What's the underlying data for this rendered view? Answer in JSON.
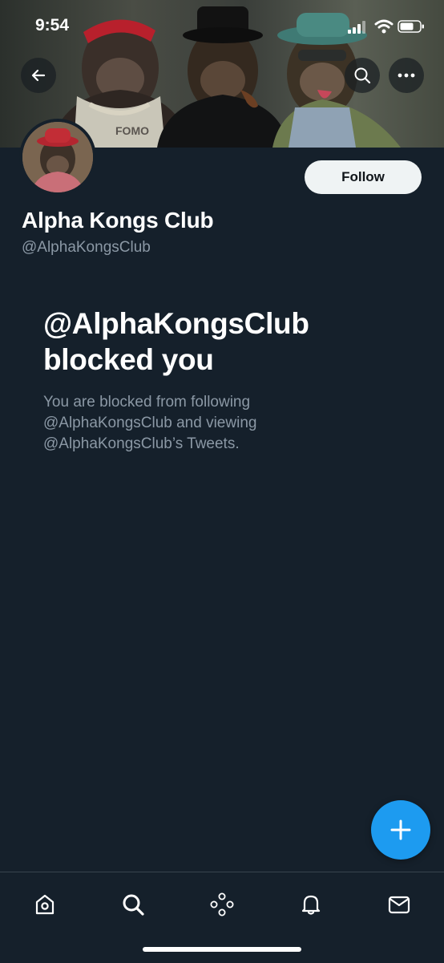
{
  "status_bar": {
    "time": "9:54"
  },
  "banner": {
    "shirt_text": "FOMO"
  },
  "profile": {
    "name": "Alpha Kongs Club",
    "handle": "@AlphaKongsClub",
    "follow_label": "Follow"
  },
  "blocked": {
    "title_line1": "@AlphaKongsClub",
    "title_line2": "blocked you",
    "desc_line1": "You are blocked from following",
    "desc_line2": "@AlphaKongsClub and viewing",
    "desc_line3": "@AlphaKongsClub’s Tweets."
  },
  "colors": {
    "background": "#15202b",
    "accent": "#1d9bf0",
    "secondary_text": "#8b98a5",
    "follow_button_bg": "#eff3f4"
  },
  "icons": {
    "back": "arrow-left-icon",
    "search": "search-icon",
    "more": "more-horizontal-icon",
    "compose": "plus-icon",
    "tabs": [
      "home-icon",
      "search-icon",
      "spaces-icon",
      "notifications-bell-icon",
      "messages-mail-icon"
    ]
  }
}
